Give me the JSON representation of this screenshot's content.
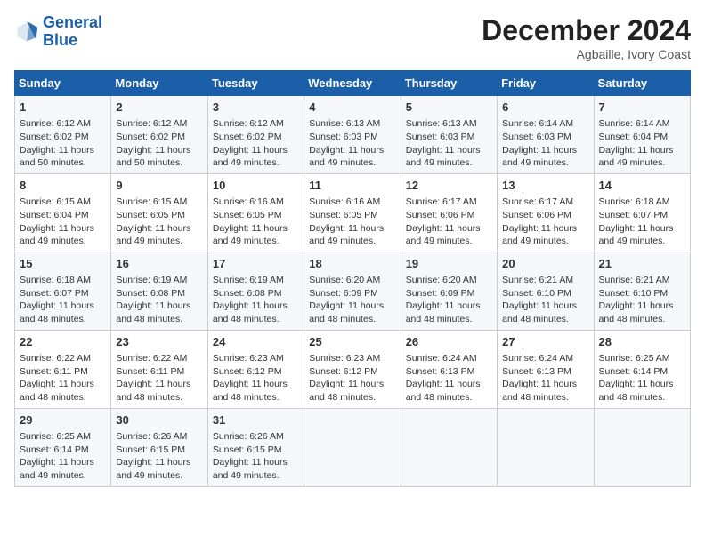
{
  "header": {
    "logo_line1": "General",
    "logo_line2": "Blue",
    "title": "December 2024",
    "subtitle": "Agbaille, Ivory Coast"
  },
  "days_of_week": [
    "Sunday",
    "Monday",
    "Tuesday",
    "Wednesday",
    "Thursday",
    "Friday",
    "Saturday"
  ],
  "weeks": [
    [
      {
        "day": "1",
        "lines": [
          "Sunrise: 6:12 AM",
          "Sunset: 6:02 PM",
          "Daylight: 11 hours",
          "and 50 minutes."
        ]
      },
      {
        "day": "2",
        "lines": [
          "Sunrise: 6:12 AM",
          "Sunset: 6:02 PM",
          "Daylight: 11 hours",
          "and 50 minutes."
        ]
      },
      {
        "day": "3",
        "lines": [
          "Sunrise: 6:12 AM",
          "Sunset: 6:02 PM",
          "Daylight: 11 hours",
          "and 49 minutes."
        ]
      },
      {
        "day": "4",
        "lines": [
          "Sunrise: 6:13 AM",
          "Sunset: 6:03 PM",
          "Daylight: 11 hours",
          "and 49 minutes."
        ]
      },
      {
        "day": "5",
        "lines": [
          "Sunrise: 6:13 AM",
          "Sunset: 6:03 PM",
          "Daylight: 11 hours",
          "and 49 minutes."
        ]
      },
      {
        "day": "6",
        "lines": [
          "Sunrise: 6:14 AM",
          "Sunset: 6:03 PM",
          "Daylight: 11 hours",
          "and 49 minutes."
        ]
      },
      {
        "day": "7",
        "lines": [
          "Sunrise: 6:14 AM",
          "Sunset: 6:04 PM",
          "Daylight: 11 hours",
          "and 49 minutes."
        ]
      }
    ],
    [
      {
        "day": "8",
        "lines": [
          "Sunrise: 6:15 AM",
          "Sunset: 6:04 PM",
          "Daylight: 11 hours",
          "and 49 minutes."
        ]
      },
      {
        "day": "9",
        "lines": [
          "Sunrise: 6:15 AM",
          "Sunset: 6:05 PM",
          "Daylight: 11 hours",
          "and 49 minutes."
        ]
      },
      {
        "day": "10",
        "lines": [
          "Sunrise: 6:16 AM",
          "Sunset: 6:05 PM",
          "Daylight: 11 hours",
          "and 49 minutes."
        ]
      },
      {
        "day": "11",
        "lines": [
          "Sunrise: 6:16 AM",
          "Sunset: 6:05 PM",
          "Daylight: 11 hours",
          "and 49 minutes."
        ]
      },
      {
        "day": "12",
        "lines": [
          "Sunrise: 6:17 AM",
          "Sunset: 6:06 PM",
          "Daylight: 11 hours",
          "and 49 minutes."
        ]
      },
      {
        "day": "13",
        "lines": [
          "Sunrise: 6:17 AM",
          "Sunset: 6:06 PM",
          "Daylight: 11 hours",
          "and 49 minutes."
        ]
      },
      {
        "day": "14",
        "lines": [
          "Sunrise: 6:18 AM",
          "Sunset: 6:07 PM",
          "Daylight: 11 hours",
          "and 49 minutes."
        ]
      }
    ],
    [
      {
        "day": "15",
        "lines": [
          "Sunrise: 6:18 AM",
          "Sunset: 6:07 PM",
          "Daylight: 11 hours",
          "and 48 minutes."
        ]
      },
      {
        "day": "16",
        "lines": [
          "Sunrise: 6:19 AM",
          "Sunset: 6:08 PM",
          "Daylight: 11 hours",
          "and 48 minutes."
        ]
      },
      {
        "day": "17",
        "lines": [
          "Sunrise: 6:19 AM",
          "Sunset: 6:08 PM",
          "Daylight: 11 hours",
          "and 48 minutes."
        ]
      },
      {
        "day": "18",
        "lines": [
          "Sunrise: 6:20 AM",
          "Sunset: 6:09 PM",
          "Daylight: 11 hours",
          "and 48 minutes."
        ]
      },
      {
        "day": "19",
        "lines": [
          "Sunrise: 6:20 AM",
          "Sunset: 6:09 PM",
          "Daylight: 11 hours",
          "and 48 minutes."
        ]
      },
      {
        "day": "20",
        "lines": [
          "Sunrise: 6:21 AM",
          "Sunset: 6:10 PM",
          "Daylight: 11 hours",
          "and 48 minutes."
        ]
      },
      {
        "day": "21",
        "lines": [
          "Sunrise: 6:21 AM",
          "Sunset: 6:10 PM",
          "Daylight: 11 hours",
          "and 48 minutes."
        ]
      }
    ],
    [
      {
        "day": "22",
        "lines": [
          "Sunrise: 6:22 AM",
          "Sunset: 6:11 PM",
          "Daylight: 11 hours",
          "and 48 minutes."
        ]
      },
      {
        "day": "23",
        "lines": [
          "Sunrise: 6:22 AM",
          "Sunset: 6:11 PM",
          "Daylight: 11 hours",
          "and 48 minutes."
        ]
      },
      {
        "day": "24",
        "lines": [
          "Sunrise: 6:23 AM",
          "Sunset: 6:12 PM",
          "Daylight: 11 hours",
          "and 48 minutes."
        ]
      },
      {
        "day": "25",
        "lines": [
          "Sunrise: 6:23 AM",
          "Sunset: 6:12 PM",
          "Daylight: 11 hours",
          "and 48 minutes."
        ]
      },
      {
        "day": "26",
        "lines": [
          "Sunrise: 6:24 AM",
          "Sunset: 6:13 PM",
          "Daylight: 11 hours",
          "and 48 minutes."
        ]
      },
      {
        "day": "27",
        "lines": [
          "Sunrise: 6:24 AM",
          "Sunset: 6:13 PM",
          "Daylight: 11 hours",
          "and 48 minutes."
        ]
      },
      {
        "day": "28",
        "lines": [
          "Sunrise: 6:25 AM",
          "Sunset: 6:14 PM",
          "Daylight: 11 hours",
          "and 48 minutes."
        ]
      }
    ],
    [
      {
        "day": "29",
        "lines": [
          "Sunrise: 6:25 AM",
          "Sunset: 6:14 PM",
          "Daylight: 11 hours",
          "and 49 minutes."
        ]
      },
      {
        "day": "30",
        "lines": [
          "Sunrise: 6:26 AM",
          "Sunset: 6:15 PM",
          "Daylight: 11 hours",
          "and 49 minutes."
        ]
      },
      {
        "day": "31",
        "lines": [
          "Sunrise: 6:26 AM",
          "Sunset: 6:15 PM",
          "Daylight: 11 hours",
          "and 49 minutes."
        ]
      },
      null,
      null,
      null,
      null
    ]
  ]
}
